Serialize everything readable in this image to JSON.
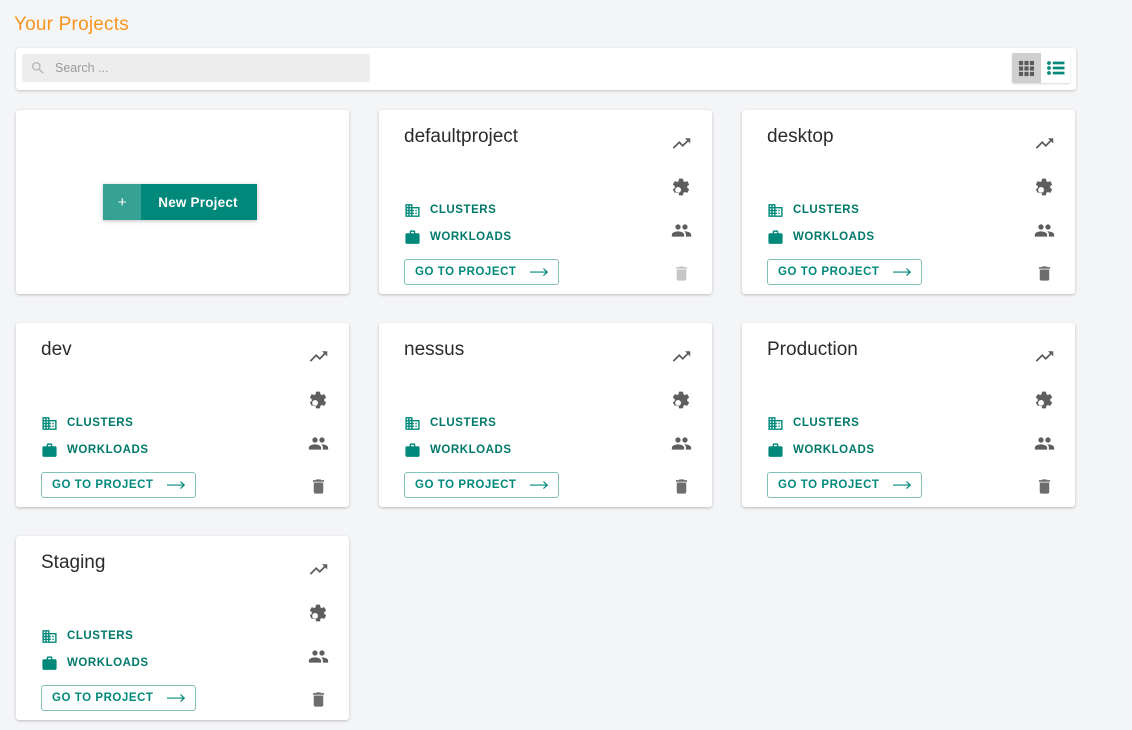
{
  "header": {
    "title": "Your Projects",
    "title_color": "#f7941e"
  },
  "toolbar": {
    "search": {
      "icon": "search-icon",
      "value": "",
      "placeholder": "Search ..."
    },
    "view_toggle": {
      "grid": {
        "label": "grid-view",
        "icon": "grid-icon",
        "active": true,
        "color": "#5a5a5a"
      },
      "list": {
        "label": "list-view",
        "icon": "list-icon",
        "active": false,
        "color": "#00897b"
      }
    }
  },
  "new_project_card": {
    "plus_label": "+",
    "label": "New Project",
    "plus_bg": "#35a295",
    "bg": "#00887a"
  },
  "card_labels": {
    "clusters": "CLUSTERS",
    "workloads": "WORKLOADS",
    "goto": "GO TO PROJECT",
    "clusters_icon": "building-icon",
    "workloads_icon": "briefcase-icon",
    "trend_icon": "trending-up-icon",
    "settings_icon": "gear-icon",
    "members_icon": "people-icon",
    "delete_icon": "trash-icon",
    "link_color": "#00796b"
  },
  "projects": [
    {
      "name": "defaultproject",
      "delete_enabled": false
    },
    {
      "name": "desktop",
      "delete_enabled": true
    },
    {
      "name": "dev",
      "delete_enabled": true
    },
    {
      "name": "nessus",
      "delete_enabled": true
    },
    {
      "name": "Production",
      "delete_enabled": true
    },
    {
      "name": "Staging",
      "delete_enabled": true
    }
  ]
}
